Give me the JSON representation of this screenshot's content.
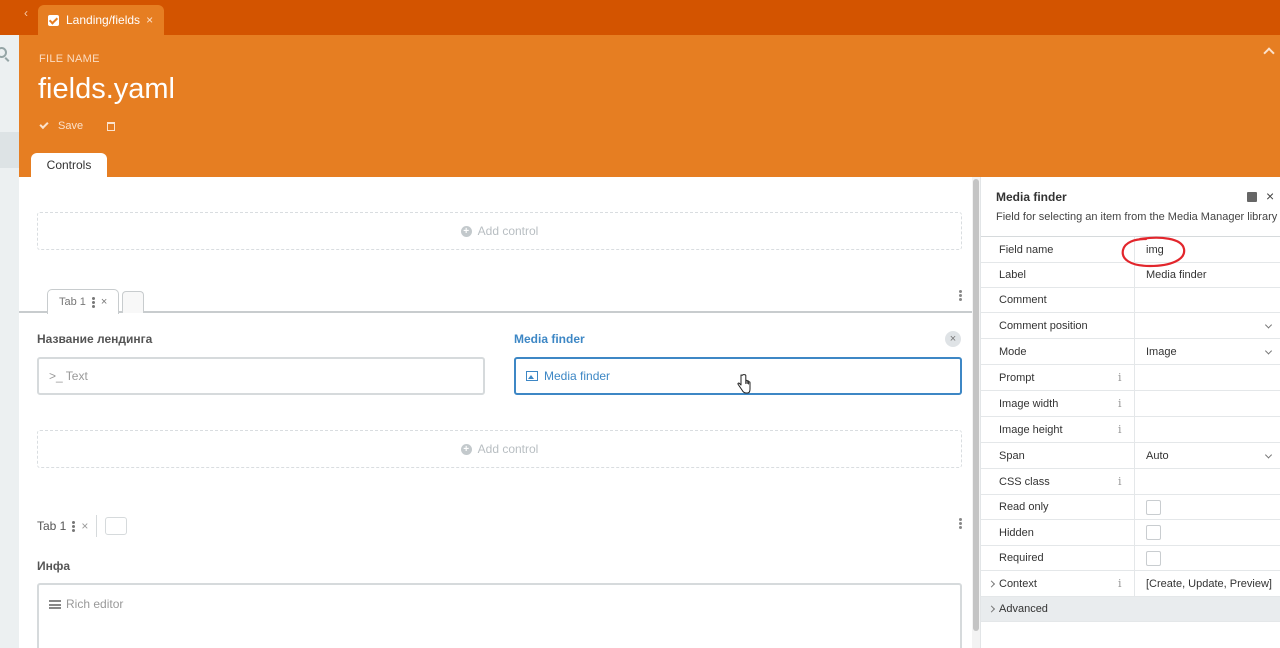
{
  "top_tab": {
    "label": "Landing/fields",
    "close": "×"
  },
  "header": {
    "file_name_label": "FILE NAME",
    "file_name": "fields.yaml",
    "save_label": "Save",
    "controls_tab": "Controls"
  },
  "form": {
    "add_control": "Add control",
    "tab1_label": "Tab 1",
    "tab_close": "×",
    "field1_label": "Название лендинга",
    "field1_placeholder": ">_ Text",
    "field2_label": "Media finder",
    "field2_value": "Media finder",
    "remove": "×",
    "tab2_label": "Tab 1",
    "field3_label": "Инфа",
    "field3_placeholder": "Rich editor"
  },
  "inspector": {
    "title": "Media finder",
    "description": "Field for selecting an item from the Media Manager library",
    "close": "×",
    "properties": [
      {
        "name": "Field name",
        "value": "img",
        "kind": "text"
      },
      {
        "name": "Label",
        "value": "Media finder",
        "kind": "text"
      },
      {
        "name": "Comment",
        "value": "",
        "kind": "text"
      },
      {
        "name": "Comment position",
        "value": "",
        "kind": "select"
      },
      {
        "name": "Mode",
        "value": "Image",
        "kind": "select"
      },
      {
        "name": "Prompt",
        "value": "",
        "kind": "text",
        "info": "i"
      },
      {
        "name": "Image width",
        "value": "",
        "kind": "text",
        "info": "i"
      },
      {
        "name": "Image height",
        "value": "",
        "kind": "text",
        "info": "i"
      },
      {
        "name": "Span",
        "value": "Auto",
        "kind": "select"
      },
      {
        "name": "CSS class",
        "value": "",
        "kind": "text",
        "info": "i"
      },
      {
        "name": "Read only",
        "value": "",
        "kind": "checkbox"
      },
      {
        "name": "Hidden",
        "value": "",
        "kind": "checkbox"
      },
      {
        "name": "Required",
        "value": "",
        "kind": "checkbox"
      },
      {
        "name": "Context",
        "value": "[Create, Update, Preview]",
        "kind": "text",
        "info": "i",
        "expandable": true
      },
      {
        "name": "Advanced",
        "value": "",
        "kind": "group",
        "expandable": true
      }
    ]
  },
  "colors": {
    "tabbar": "#d35400",
    "header": "#e67e22",
    "active_field": "#3d87c5",
    "annotation": "#e2262c"
  }
}
